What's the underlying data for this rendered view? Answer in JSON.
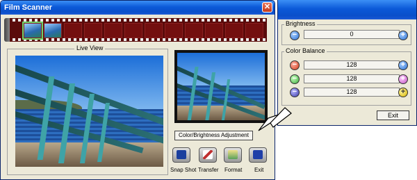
{
  "scanner": {
    "title": "Film Scanner",
    "close_glyph": "✕",
    "live_view_label": "Live  View",
    "adjust_button": "Color/Brightness Adjustment",
    "tools": [
      {
        "label": "Snap Shot",
        "icon": "camera-icon"
      },
      {
        "label": "Transfer",
        "icon": "transfer-icon"
      },
      {
        "label": "Format",
        "icon": "format-icon"
      },
      {
        "label": "Exit",
        "icon": "exit-icon"
      }
    ]
  },
  "adjust_panel": {
    "brightness_label": "Brightness",
    "brightness_value": "0",
    "color_balance_label": "Color Balance",
    "color_values": [
      "128",
      "128",
      "128"
    ],
    "exit_label": "Exit"
  },
  "colors": {
    "titlebar": "#0b59d8",
    "window_bg": "#ece9d8",
    "film": "#5a0b0b",
    "railing": "#3fa3a7"
  }
}
